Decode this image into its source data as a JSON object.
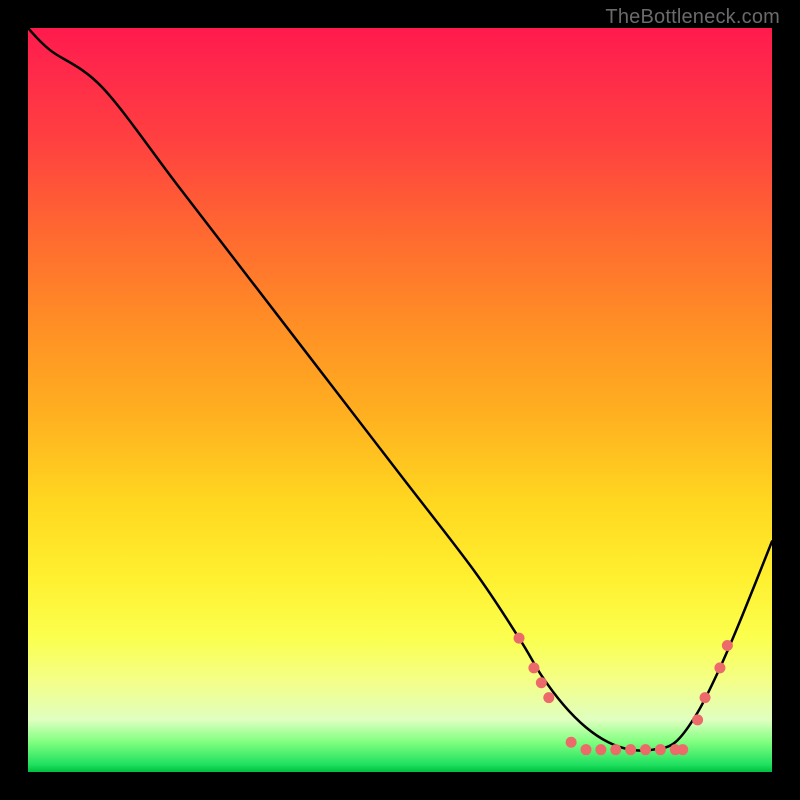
{
  "attribution": "TheBottleneck.com",
  "colors": {
    "bg": "#000000",
    "curve": "#000000",
    "marker": "#ed6a6a",
    "gradient_top": "#ff1a4d",
    "gradient_bottom": "#00c040"
  },
  "chart_data": {
    "type": "line",
    "title": "",
    "xlabel": "",
    "ylabel": "",
    "xlim": [
      0,
      100
    ],
    "ylim": [
      0,
      100
    ],
    "grid": false,
    "series": [
      {
        "name": "curve",
        "x": [
          0,
          3,
          10,
          20,
          30,
          40,
          50,
          60,
          66,
          69,
          72,
          75,
          78,
          81,
          84,
          87,
          90,
          93,
          96,
          100
        ],
        "y": [
          100,
          97,
          92,
          79,
          66,
          53,
          40,
          27,
          18,
          13,
          9,
          6,
          4,
          3,
          3,
          4,
          8,
          14,
          21,
          31
        ]
      }
    ],
    "markers": [
      {
        "x": 66,
        "y": 18
      },
      {
        "x": 68,
        "y": 14
      },
      {
        "x": 69,
        "y": 12
      },
      {
        "x": 70,
        "y": 10
      },
      {
        "x": 73,
        "y": 4
      },
      {
        "x": 75,
        "y": 3
      },
      {
        "x": 77,
        "y": 3
      },
      {
        "x": 79,
        "y": 3
      },
      {
        "x": 81,
        "y": 3
      },
      {
        "x": 83,
        "y": 3
      },
      {
        "x": 85,
        "y": 3
      },
      {
        "x": 87,
        "y": 3
      },
      {
        "x": 88,
        "y": 3
      },
      {
        "x": 90,
        "y": 7
      },
      {
        "x": 91,
        "y": 10
      },
      {
        "x": 93,
        "y": 14
      },
      {
        "x": 94,
        "y": 17
      }
    ]
  }
}
